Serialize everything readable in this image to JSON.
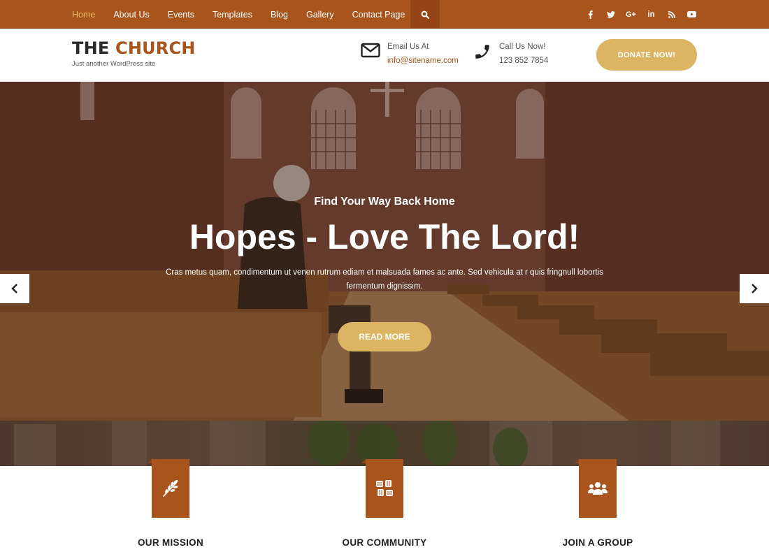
{
  "colors": {
    "brand": "#a9541c",
    "accent_gold": "#dcb462",
    "active_nav": "#e8b865"
  },
  "nav": {
    "items": [
      {
        "label": "Home",
        "active": true
      },
      {
        "label": "About Us",
        "active": false
      },
      {
        "label": "Events",
        "active": false
      },
      {
        "label": "Templates",
        "active": false
      },
      {
        "label": "Blog",
        "active": false
      },
      {
        "label": "Gallery",
        "active": false
      },
      {
        "label": "Contact Page",
        "active": false
      }
    ],
    "search_icon": "search-icon",
    "social": [
      {
        "name": "facebook",
        "glyph": "f"
      },
      {
        "name": "twitter",
        "glyph": "t"
      },
      {
        "name": "google-plus",
        "glyph": "G+"
      },
      {
        "name": "linkedin",
        "glyph": "in"
      },
      {
        "name": "rss",
        "glyph": "rss"
      },
      {
        "name": "youtube",
        "glyph": "yt"
      }
    ]
  },
  "header": {
    "logo_the": "THE",
    "logo_church": "CHURCH",
    "tagline": "Just another WordPress site",
    "email_label": "Email Us At",
    "email": "info@sitename.com",
    "phone_label": "Call Us Now!",
    "phone": "123 852 7854",
    "donate_label": "DONATE NOW!"
  },
  "hero": {
    "subtitle": "Find Your Way Back Home",
    "title": "Hopes - Love The Lord!",
    "description": "Cras metus quam, condimentum ut venen rutrum ediam et malsuada fames ac ante. Sed vehicula at r quis fringnull lobortis fermentum dignissim.",
    "cta_label": "READ MORE",
    "prev_icon": "chevron-left-icon",
    "next_icon": "chevron-right-icon"
  },
  "features": [
    {
      "title": "OUR MISSION",
      "icon": "olive-branch-icon"
    },
    {
      "title": "OUR COMMUNITY",
      "icon": "hands-together-icon"
    },
    {
      "title": "JOIN A GROUP",
      "icon": "users-group-icon"
    }
  ]
}
